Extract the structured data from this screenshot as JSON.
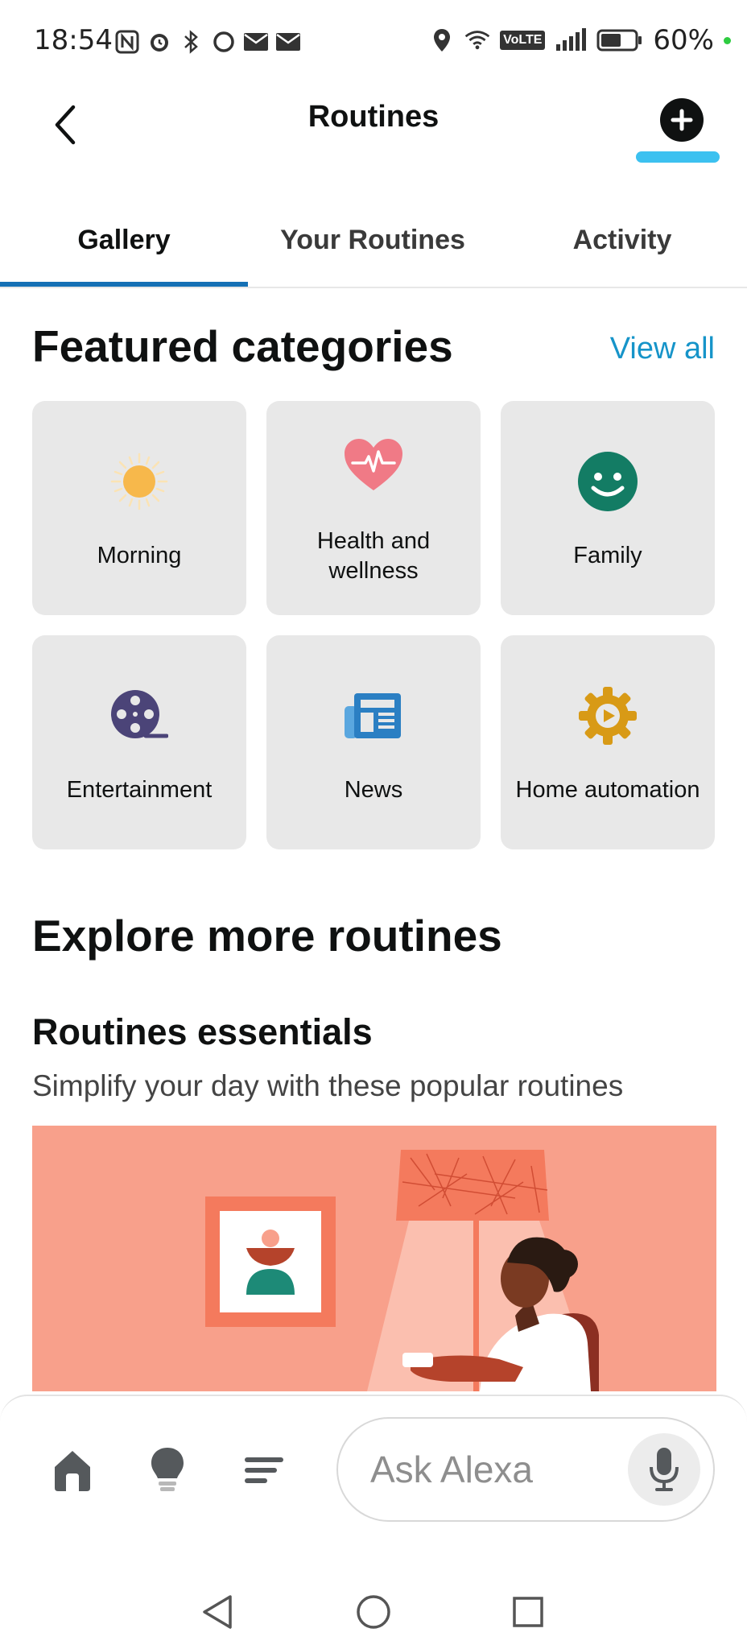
{
  "status_bar": {
    "time": "18:54",
    "left_icons": [
      "nfc-icon",
      "alarm-icon",
      "bluetooth-icon",
      "circle-icon",
      "mail-icon",
      "mail-icon"
    ],
    "right_icons": [
      "location-icon",
      "wifi-icon",
      "volte-icon",
      "signal-icon",
      "battery-icon"
    ],
    "volte_label": "VoLTE",
    "battery_percent": "60%",
    "battery_level": 0.6
  },
  "header": {
    "title": "Routines",
    "back_icon": "chevron-left-icon",
    "add_icon": "plus-circle-icon"
  },
  "tabs": [
    {
      "label": "Gallery",
      "active": true
    },
    {
      "label": "Your Routines",
      "active": false
    },
    {
      "label": "Activity",
      "active": false
    }
  ],
  "featured": {
    "title": "Featured categories",
    "view_all": "View all",
    "categories": [
      {
        "label": "Morning",
        "icon": "sun-icon",
        "color": "#f7b84b"
      },
      {
        "label": "Health and wellness",
        "icon": "heart-pulse-icon",
        "color": "#f07a86"
      },
      {
        "label": "Family",
        "icon": "smiley-face-icon",
        "color": "#137c64"
      },
      {
        "label": "Entertainment",
        "icon": "film-reel-icon",
        "color": "#4b4478"
      },
      {
        "label": "News",
        "icon": "newspaper-icon",
        "color": "#2b7fc3"
      },
      {
        "label": "Home automation",
        "icon": "gear-play-icon",
        "color": "#d89a16"
      }
    ]
  },
  "explore": {
    "title": "Explore more routines",
    "essentials_title": "Routines essentials",
    "essentials_subtitle": "Simplify your day with these popular routines"
  },
  "bottom_nav": {
    "items": [
      {
        "icon": "home-icon"
      },
      {
        "icon": "lightbulb-icon"
      },
      {
        "icon": "menu-lines-icon"
      }
    ],
    "ask_placeholder": "Ask Alexa",
    "mic_icon": "microphone-icon"
  },
  "system_nav": [
    "back-triangle-icon",
    "home-circle-icon",
    "recents-square-icon"
  ],
  "colors": {
    "accent_blue": "#1694c9",
    "tab_indicator": "#1570b5",
    "add_underline": "#3cc1f0",
    "card_bg": "#e8e8e8",
    "banner_bg": "#f8a08b"
  }
}
